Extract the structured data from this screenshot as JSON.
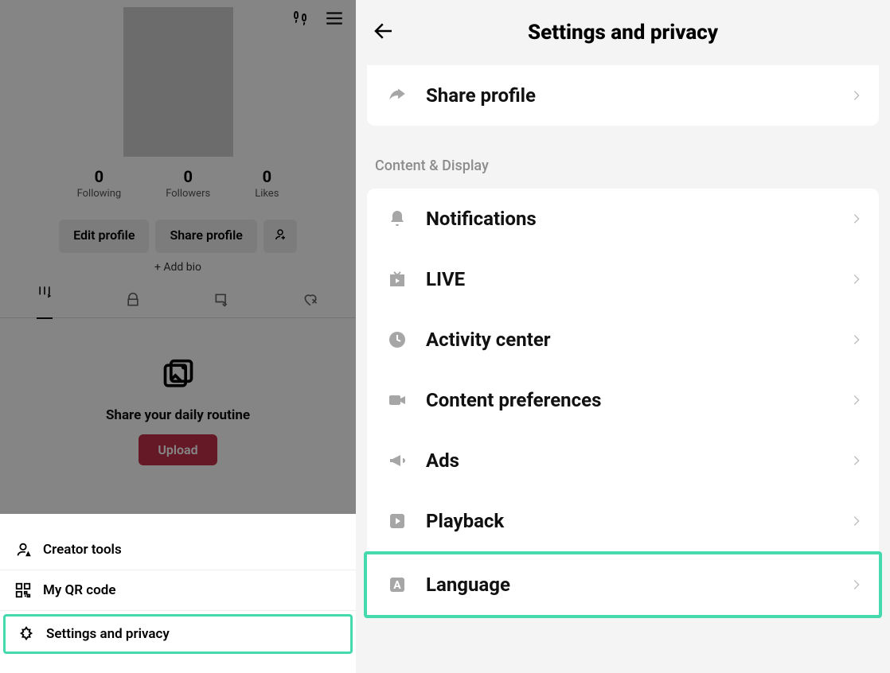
{
  "left": {
    "stats": [
      {
        "count": "0",
        "label": "Following"
      },
      {
        "count": "0",
        "label": "Followers"
      },
      {
        "count": "0",
        "label": "Likes"
      }
    ],
    "buttons": {
      "edit": "Edit profile",
      "share": "Share profile"
    },
    "add_bio": "+ Add bio",
    "empty_msg": "Share your daily routine",
    "upload": "Upload",
    "sheet": {
      "creator": "Creator tools",
      "qr": "My QR code",
      "settings": "Settings and privacy"
    }
  },
  "right": {
    "title": "Settings and privacy",
    "share_profile": "Share profile",
    "section_label": "Content & Display",
    "items": {
      "notifications": "Notifications",
      "live": "LIVE",
      "activity": "Activity center",
      "content_prefs": "Content preferences",
      "ads": "Ads",
      "playback": "Playback",
      "language": "Language"
    }
  }
}
